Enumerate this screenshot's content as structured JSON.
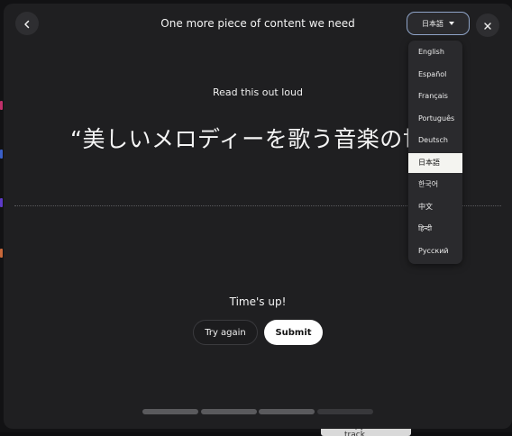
{
  "header": {
    "title": "One more piece of content we need",
    "language_selected": "日本語"
  },
  "language_menu": {
    "items": [
      {
        "label": "English",
        "selected": false
      },
      {
        "label": "Español",
        "selected": false
      },
      {
        "label": "Français",
        "selected": false
      },
      {
        "label": "Português",
        "selected": false
      },
      {
        "label": "Deutsch",
        "selected": false
      },
      {
        "label": "日本語",
        "selected": true
      },
      {
        "label": "한국어",
        "selected": false
      },
      {
        "label": "中文",
        "selected": false
      },
      {
        "label": "हिन्दी",
        "selected": false
      },
      {
        "label": "Русский",
        "selected": false
      }
    ]
  },
  "main": {
    "instruction": "Read this out loud",
    "prompt_text": "“美しいメロディーを歌う音楽の世",
    "status": "Time's up!"
  },
  "actions": {
    "try_again_label": "Try again",
    "submit_label": "Submit"
  },
  "progress": {
    "steps_total": 4,
    "steps_completed": 3
  },
  "background": {
    "chip_text": "Copy to main track"
  },
  "icons": {
    "back": "chevron-left-icon",
    "close": "close-icon",
    "language_caret": "caret-down-icon"
  },
  "colors": {
    "modal_bg": "#1f1f21",
    "language_button_border": "#8fa4c8",
    "submit_bg": "#ffffff",
    "selected_item_bg": "#f4f4f0",
    "progress_done": "#5a5a5d",
    "progress_pending": "#38383b"
  }
}
